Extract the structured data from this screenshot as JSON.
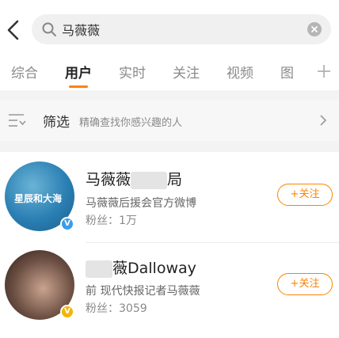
{
  "search": {
    "value": "马薇薇",
    "placeholder": ""
  },
  "tabs": [
    {
      "label": "综合"
    },
    {
      "label": "用户"
    },
    {
      "label": "实时"
    },
    {
      "label": "关注"
    },
    {
      "label": "视频"
    },
    {
      "label": "图"
    }
  ],
  "active_tab": "用户",
  "filter": {
    "title": "筛选",
    "description": "精确查找你感兴趣的人"
  },
  "users": [
    {
      "name_prefix": "马薇薇",
      "name_suffix": "局",
      "avatar_text": "星辰和大海",
      "description": "马薇薇后援会官方微博",
      "followers": "粉丝：1万",
      "follow_label": "+关注",
      "verified": "V"
    },
    {
      "name_prefix": "",
      "name_suffix": "薇Dalloway",
      "avatar_text": "",
      "description": "前 现代快报记者马薇薇",
      "followers": "粉丝：3059",
      "follow_label": "+关注",
      "verified": "V"
    }
  ],
  "colors": {
    "accent": "#ff8200",
    "verified_blue": "#3a9ce9",
    "verified_gold": "#f5b400"
  }
}
